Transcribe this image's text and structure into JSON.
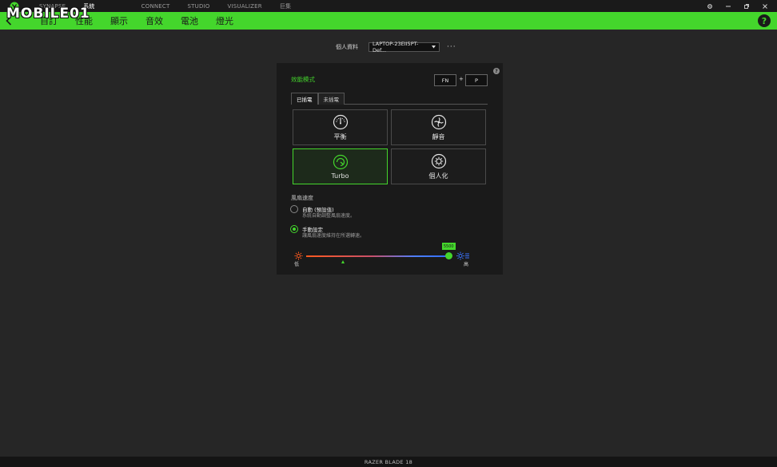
{
  "watermark": {
    "text": "MOBILE01"
  },
  "topnav": {
    "items": [
      "SYNAPSE",
      "系統",
      "",
      "CONNECT",
      "STUDIO",
      "VISUALIZER",
      "巨集"
    ],
    "active_index": 1
  },
  "subnav": {
    "items": [
      "自訂",
      "性能",
      "顯示",
      "音效",
      "電池",
      "燈光"
    ]
  },
  "help": {
    "label": "?"
  },
  "profile": {
    "label": "個人資料",
    "value": "LAPTOP-23EII5PT-Def...",
    "more": "···"
  },
  "panel": {
    "title": "效能模式",
    "info": "?",
    "shortcut": {
      "key1": "FN",
      "plus": "+",
      "key2": "P"
    },
    "tabs": [
      "已插電",
      "未插電"
    ],
    "active_tab": 0,
    "modes": [
      {
        "label": "平衡",
        "icon": "gauge-icon"
      },
      {
        "label": "靜音",
        "icon": "fan-icon"
      },
      {
        "label": "Turbo",
        "icon": "turbo-icon",
        "selected": true
      },
      {
        "label": "個人化",
        "icon": "gear-icon"
      }
    ],
    "fan": {
      "title": "風扇速度",
      "options": [
        {
          "title": "自動 (預設值)",
          "desc": "系統自動調整風扇速度。",
          "selected": false
        },
        {
          "title": "手動設定",
          "desc": "讓風扇速度維持在所選轉速。",
          "selected": true
        }
      ],
      "slider": {
        "value_label": "5500",
        "value_fraction": 0.98,
        "low_label": "低",
        "high_label": "高"
      }
    }
  },
  "footer": {
    "device": "RAZER BLADE 18"
  },
  "colors": {
    "accent": "#44d62c",
    "background": "#262626",
    "panel": "#1a1a1a"
  }
}
